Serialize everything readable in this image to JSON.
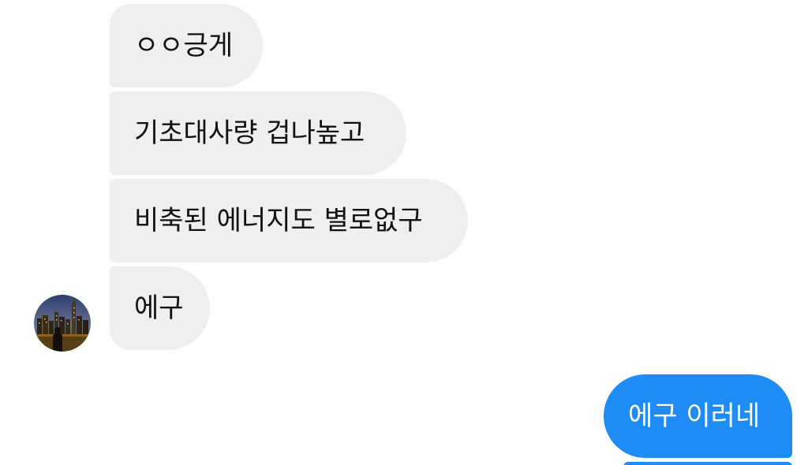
{
  "conversation": {
    "incoming": [
      {
        "text": "ㅇㅇ긍게"
      },
      {
        "text": "기초대사량 겁나높고"
      },
      {
        "text": "비축된 에너지도 별로없구"
      },
      {
        "text": "에구"
      }
    ],
    "outgoing": [
      {
        "text": "에구 이러네"
      }
    ]
  },
  "avatar": {
    "icon": "city-skyline-photo"
  },
  "colors": {
    "incoming_bubble": "#efefef",
    "outgoing_bubble": "#1f8cf6",
    "outgoing_text": "#ffffff"
  }
}
